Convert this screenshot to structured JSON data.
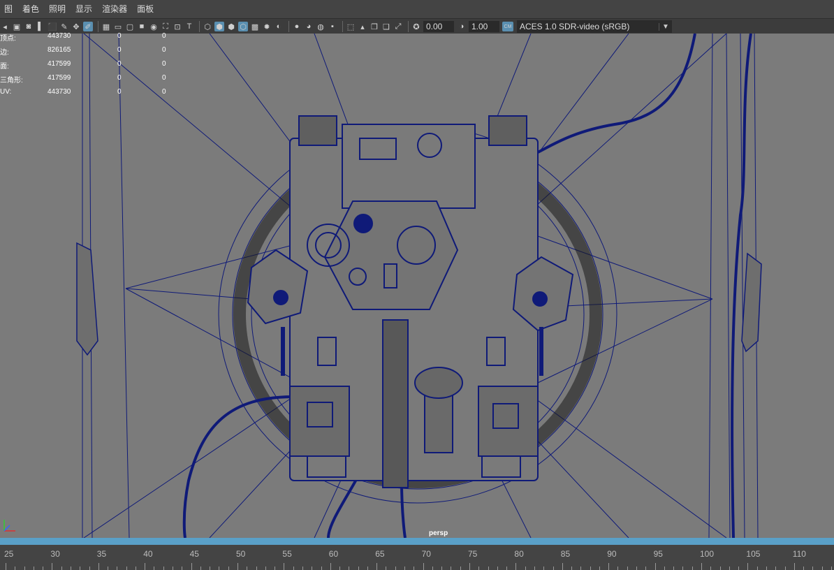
{
  "menu": [
    "图",
    "着色",
    "照明",
    "显示",
    "渲染器",
    "面板"
  ],
  "toolbar": {
    "field1": "0.00",
    "field2": "1.00",
    "colorspace_badge": "CM",
    "colorspace": "ACES 1.0 SDR-video (sRGB)"
  },
  "hud": {
    "rows": [
      {
        "label": "顶点:",
        "total": "443730",
        "a": "0",
        "b": "0"
      },
      {
        "label": "边:",
        "total": "826165",
        "a": "0",
        "b": "0"
      },
      {
        "label": "面:",
        "total": "417599",
        "a": "0",
        "b": "0"
      },
      {
        "label": "三角形:",
        "total": "417599",
        "a": "0",
        "b": "0"
      },
      {
        "label": "UV:",
        "total": "443730",
        "a": "0",
        "b": "0"
      }
    ]
  },
  "viewport": {
    "camera": "persp"
  },
  "timeline": {
    "ticks": [
      "25",
      "30",
      "35",
      "40",
      "45",
      "50",
      "55",
      "60",
      "65",
      "70",
      "75",
      "80",
      "85",
      "90",
      "95",
      "100",
      "105",
      "110"
    ]
  },
  "colors": {
    "wire": "#0f1a78",
    "viewport_bg": "#7b7b7b",
    "accent": "#5aa0c8"
  }
}
